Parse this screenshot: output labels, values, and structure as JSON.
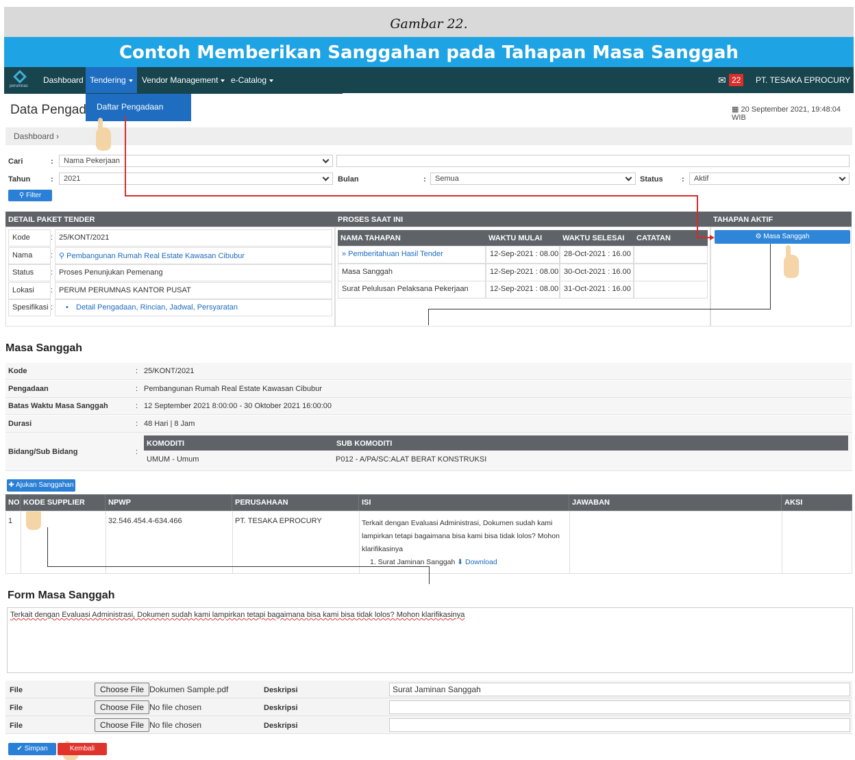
{
  "caption": "Gambar 22.",
  "banner": "Contoh Memberikan Sanggahan pada Tahapan Masa Sanggah",
  "nav": {
    "logo_text": "perumnas",
    "dashboard": "Dashboard",
    "tendering": "Tendering",
    "vendor": "Vendor Management",
    "catalog": "e-Catalog",
    "badge": "22",
    "company": "PT. TESAKA EPROCURY"
  },
  "dropdown": {
    "item": "Daftar Pengadaan"
  },
  "page": {
    "title": "Data Pengad",
    "date": "20 September 2021, 19:48:04 WIB",
    "breadcrumb": "Dashboard ›"
  },
  "filter": {
    "cari_label": "Cari",
    "cari_value": "Nama Pekerjaan",
    "tahun_label": "Tahun",
    "tahun_value": "2021",
    "bulan_label": "Bulan",
    "bulan_value": "Semua",
    "status_label": "Status",
    "status_value": "Aktif",
    "colon": ":",
    "filter_btn": "Filter"
  },
  "detail": {
    "header": "DETAIL PAKET TENDER",
    "rows": [
      {
        "k": "Kode",
        "v": "25/KONT/2021"
      },
      {
        "k": "Nama",
        "v": "Pembangunan Rumah Real Estate Kawasan Cibubur"
      },
      {
        "k": "Status",
        "v": "Proses Penunjukan Pemenang"
      },
      {
        "k": "Lokasi",
        "v": "PERUM PERUMNAS KANTOR PUSAT"
      },
      {
        "k": "Spesifikasi",
        "v": "Detail Pengadaan, Rincian, Jadwal, Persyaratan"
      }
    ]
  },
  "proses": {
    "header": "PROSES SAAT INI",
    "cols": [
      "NAMA TAHAPAN",
      "WAKTU MULAI",
      "WAKTU SELESAI",
      "CATATAN"
    ],
    "rows": [
      [
        "» Pemberitahuan Hasil Tender",
        "12-Sep-2021 : 08.00",
        "28-Oct-2021 : 16.00",
        ""
      ],
      [
        "Masa Sanggah",
        "12-Sep-2021 : 08.00",
        "30-Oct-2021 : 16.00",
        ""
      ],
      [
        "Surat Pelulusan Pelaksana Pekerjaan",
        "12-Sep-2021 : 08.00",
        "31-Oct-2021 : 16.00",
        ""
      ]
    ]
  },
  "tahapan": {
    "header": "TAHAPAN AKTIF",
    "button": "Masa Sanggah"
  },
  "masa": {
    "title": "Masa Sanggah",
    "rows": [
      {
        "k": "Kode",
        "v": "25/KONT/2021"
      },
      {
        "k": "Pengadaan",
        "v": "Pembangunan Rumah Real Estate Kawasan Cibubur"
      },
      {
        "k": "Batas Waktu Masa Sanggah",
        "v": "12 September 2021 8:00:00 - 30 Oktober 2021 16:00:00"
      },
      {
        "k": "Durasi",
        "v": "48 Hari | 8 Jam"
      }
    ],
    "bidang_label": "Bidang/Sub Bidang",
    "komoditi_h": "KOMODITI",
    "sub_h": "SUB KOMODITI",
    "komoditi": "UMUM - Umum",
    "sub": "P012 - A/PA/SC:ALAT BERAT KONSTRUKSI"
  },
  "sanggah": {
    "button": "Ajukan Sanggahan",
    "cols": [
      "NO",
      "KODE SUPPLIER",
      "NPWP",
      "PERUSAHAAN",
      "ISI",
      "JAWABAN",
      "AKSI"
    ],
    "row": {
      "no": "1",
      "npwp": "32.546.454.4-634.466",
      "perusahaan": "PT. TESAKA EPROCURY",
      "isi1": "Terkait dengan Evaluasi Administrasi, Dokumen sudah kami",
      "isi2": "lampirkan tetapi bagaimana bisa kami bisa tidak lolos? Mohon",
      "isi3": "klarifikasinya",
      "att": "1. Surat Jaminan Sanggah",
      "dl": "Download"
    }
  },
  "form": {
    "title": "Form Masa Sanggah",
    "text": "Terkait dengan Evaluasi Administrasi, Dokumen sudah kami lampirkan tetapi bagaimana bisa kami bisa tidak lolos? Mohon klarifikasinya",
    "file_label": "File",
    "choose": "Choose File",
    "desk_label": "Deskripsi",
    "files": [
      {
        "name": "Dokumen Sample.pdf",
        "desc": "Surat Jaminan Sanggah"
      },
      {
        "name": "No file chosen",
        "desc": ""
      },
      {
        "name": "No file chosen",
        "desc": ""
      }
    ],
    "simpan": "Simpan",
    "kembali": "Kembali"
  }
}
